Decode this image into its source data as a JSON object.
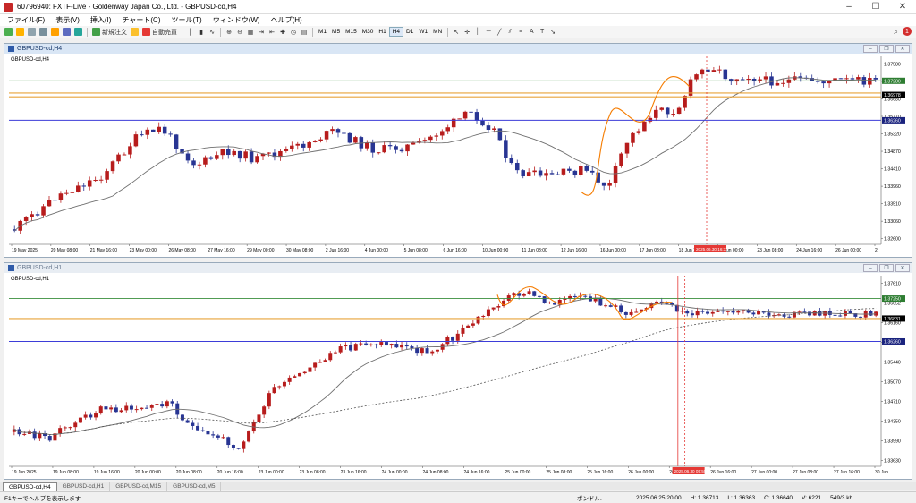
{
  "window": {
    "title": "60796940: FXTF-Live - Goldenway Japan Co., Ltd. - GBPUSD-cd,H4",
    "minimize": "–",
    "maximize": "☐",
    "close": "✕"
  },
  "menu": [
    "ファイル(F)",
    "表示(V)",
    "挿入(I)",
    "チャート(C)",
    "ツール(T)",
    "ウィンドウ(W)",
    "ヘルプ(H)"
  ],
  "toolbar": {
    "new_order": "新規注文",
    "auto_trading": "自動売買",
    "timeframes": [
      "M1",
      "M5",
      "M15",
      "M30",
      "H1",
      "H4",
      "D1",
      "W1",
      "MN"
    ],
    "active_timeframe": "H4",
    "notification_count": "1"
  },
  "charts": [
    {
      "window_title": "GBPUSD-cd,H4",
      "symbol_label": "GBPUSD-cd,H4",
      "price_ticks": [
        "1.37580",
        "1.37130",
        "1.36680",
        "1.35770",
        "1.35320",
        "1.34870",
        "1.34410",
        "1.33960",
        "1.33510",
        "1.33060",
        "1.32600"
      ],
      "level_tags": [
        {
          "text": "1.37280",
          "color": "#2e7d32"
        },
        {
          "text": "1.36978",
          "color": "#000000"
        },
        {
          "text": "1.36260",
          "color": "#1a237e"
        }
      ],
      "time_labels": [
        "19 May 2025",
        "20 May 08:00",
        "21 May 16:00",
        "23 May 00:00",
        "26 May 08:00",
        "27 May 16:00",
        "29 May 00:00",
        "30 May 08:00",
        "2 Jun 16:00",
        "4 Jun 00:00",
        "5 Jun 08:00",
        "6 Jun 16:00",
        "10 Jun 00:00",
        "11 Jun 08:00",
        "12 Jun 16:00",
        "16 Jun 00:00",
        "17 Jun 08:00",
        "18 Jun 16:00",
        "20 Jun 00:00",
        "23 Jun 08:00",
        "24 Jun 16:00",
        "26 Jun 00:00",
        "2"
      ],
      "cursor_time": "2025.06.30 16:33"
    },
    {
      "window_title": "GBPUSD-cd,H1",
      "symbol_label": "GBPUSD-cd,H1",
      "price_ticks": [
        "1.37610",
        "1.36652",
        "1.36160",
        "1.35800",
        "1.35440",
        "1.35070",
        "1.34710",
        "1.34350",
        "1.33990",
        "1.33630"
      ],
      "level_tags": [
        {
          "text": "1.37250",
          "color": "#2e7d32"
        },
        {
          "text": "1.36831",
          "color": "#000000"
        },
        {
          "text": "1.36260",
          "color": "#1a237e"
        }
      ],
      "time_labels": [
        "19 Jun 2025",
        "19 Jun 08:00",
        "19 Jun 16:00",
        "20 Jun 00:00",
        "20 Jun 08:00",
        "20 Jun 16:00",
        "23 Jun 00:00",
        "23 Jun 08:00",
        "23 Jun 16:00",
        "24 Jun 00:00",
        "24 Jun 08:00",
        "24 Jun 16:00",
        "25 Jun 00:00",
        "25 Jun 08:00",
        "25 Jun 16:00",
        "26 Jun 00:00",
        "26 Jun 08:00",
        "26 Jun 16:00",
        "27 Jun 00:00",
        "27 Jun 08:00",
        "27 Jun 16:00",
        "30 Jun"
      ],
      "cursor_time": "2025.06.30 05:55"
    }
  ],
  "bottom_tabs": [
    "GBPUSD-cd,H4",
    "GBPUSD-cd,H1",
    "GBPUSD-cd,M15",
    "GBPUSD-cd,M5"
  ],
  "status": {
    "left": "F1キーでヘルプを表示します",
    "profile": "ボンドル.",
    "datetime": "2025.06.25 20:00",
    "high": "H: 1.36713",
    "low": "L: 1.36363",
    "close": "C: 1.36640",
    "volume": "V: 6221",
    "traffic": "549/3 kb"
  },
  "colors": {
    "bull": "#b71c1c",
    "bear": "#283593",
    "ma": "#707070",
    "curve": "#f57c00",
    "green": "#388e3c",
    "gold": "#e8a33a",
    "blue": "#3d3dd8",
    "cursor": "#e53935"
  }
}
